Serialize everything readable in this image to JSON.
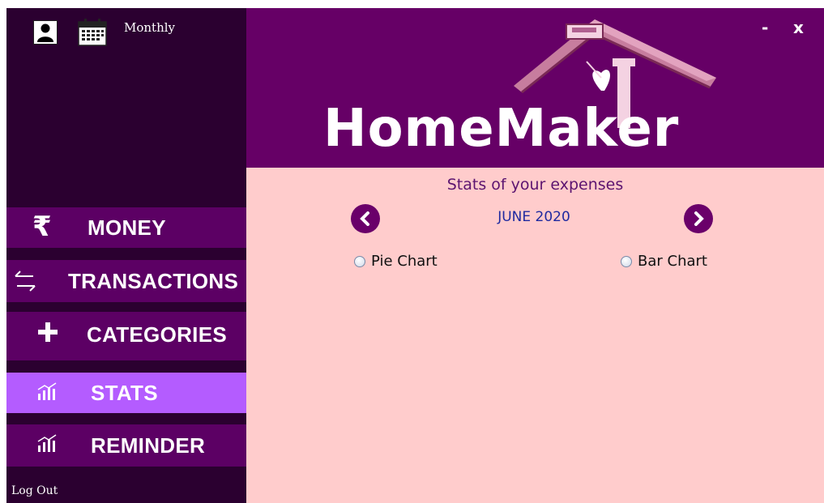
{
  "window": {
    "minimize_label": "-",
    "close_label": "x"
  },
  "sidebar": {
    "period_label": "Monthly",
    "items": [
      {
        "label": "MONEY",
        "icon": "rupee-icon"
      },
      {
        "label": "TRANSACTIONS",
        "icon": "arrows-exchange-icon"
      },
      {
        "label": "CATEGORIES",
        "icon": "plus-icon"
      },
      {
        "label": "STATS",
        "icon": "bar-chart-icon",
        "active": true
      },
      {
        "label": "REMINDER",
        "icon": "bar-chart-icon"
      }
    ],
    "logout_label": "Log Out"
  },
  "header": {
    "logo_text": "HomeMaker"
  },
  "main": {
    "title": "Stats of your expenses",
    "month": "JUNE 2020",
    "options": [
      {
        "label": "Pie Chart"
      },
      {
        "label": "Bar Chart"
      }
    ]
  },
  "colors": {
    "sidebar_bg": "#2b0030",
    "nav_item_bg": "#5c0064",
    "nav_active_bg": "#b45cff",
    "header_bg": "#660066",
    "content_bg": "#ffcccc",
    "month_text": "#1f2aa0"
  }
}
